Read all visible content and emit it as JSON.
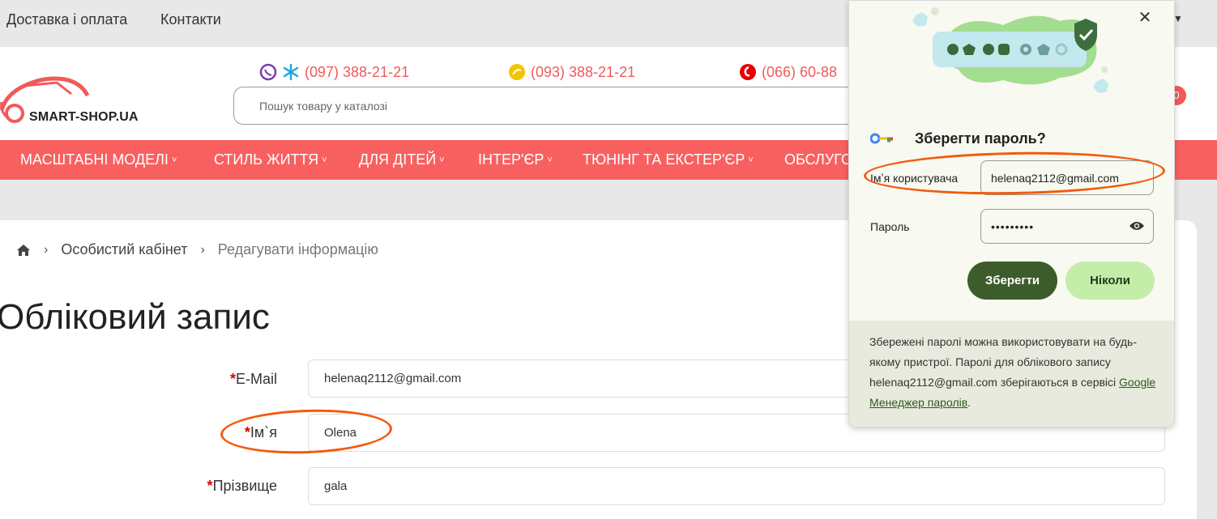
{
  "topbar": {
    "links": [
      "Доставка і оплата",
      "Контакти"
    ]
  },
  "header": {
    "logo_text": "SMART-SHOP.UA",
    "phones": [
      {
        "number": "(097) 388-21-21",
        "icons": [
          "viber-icon",
          "kyivstar-icon"
        ]
      },
      {
        "number": "(093) 388-21-21",
        "icons": [
          "lifecell-icon"
        ]
      },
      {
        "number": "(066) 60-88",
        "icons": [
          "vodafone-icon"
        ]
      }
    ],
    "search_placeholder": "Пошук товару у каталозі",
    "cart_count": "0"
  },
  "nav": {
    "items": [
      "МАСШТАБНІ МОДЕЛІ",
      "СТИЛЬ ЖИТТЯ",
      "ДЛЯ ДІТЕЙ",
      "ІНТЕР'ЄР",
      "ТЮНІНГ ТА ЕКСТЕР'ЄР",
      "ОБСЛУГО"
    ]
  },
  "breadcrumb": {
    "items": [
      "Особистий кабінет",
      "Редагувати інформацію"
    ]
  },
  "page": {
    "title": "Обліковий запис"
  },
  "form": {
    "email_label": "E-Mail",
    "email_value": "helenaq2112@gmail.com",
    "name_label": "Ім`я",
    "name_value": "Olena",
    "surname_label": "Прізвище",
    "surname_value": "gala",
    "required_mark": "*"
  },
  "password_popup": {
    "title": "Зберегти пароль?",
    "username_label": "Імʼя користувача",
    "username_value": "helenaq2112@gmail.com",
    "password_label": "Пароль",
    "password_value": "•••••••••",
    "save_label": "Зберегти",
    "never_label": "Ніколи",
    "footer_text": "Збережені паролі можна використовувати на будь-якому пристрої. Паролі для облікового запису helenaq2112@gmail.com зберігаються в сервісі ",
    "footer_link": "Google Менеджер паролів",
    "footer_end": "."
  },
  "colors": {
    "brand_red": "#f86060",
    "phone_red": "#f05a5a",
    "popup_green_dark": "#3d5c2b",
    "popup_green_light": "#c5edaa",
    "annotation_orange": "#f25b0e"
  }
}
